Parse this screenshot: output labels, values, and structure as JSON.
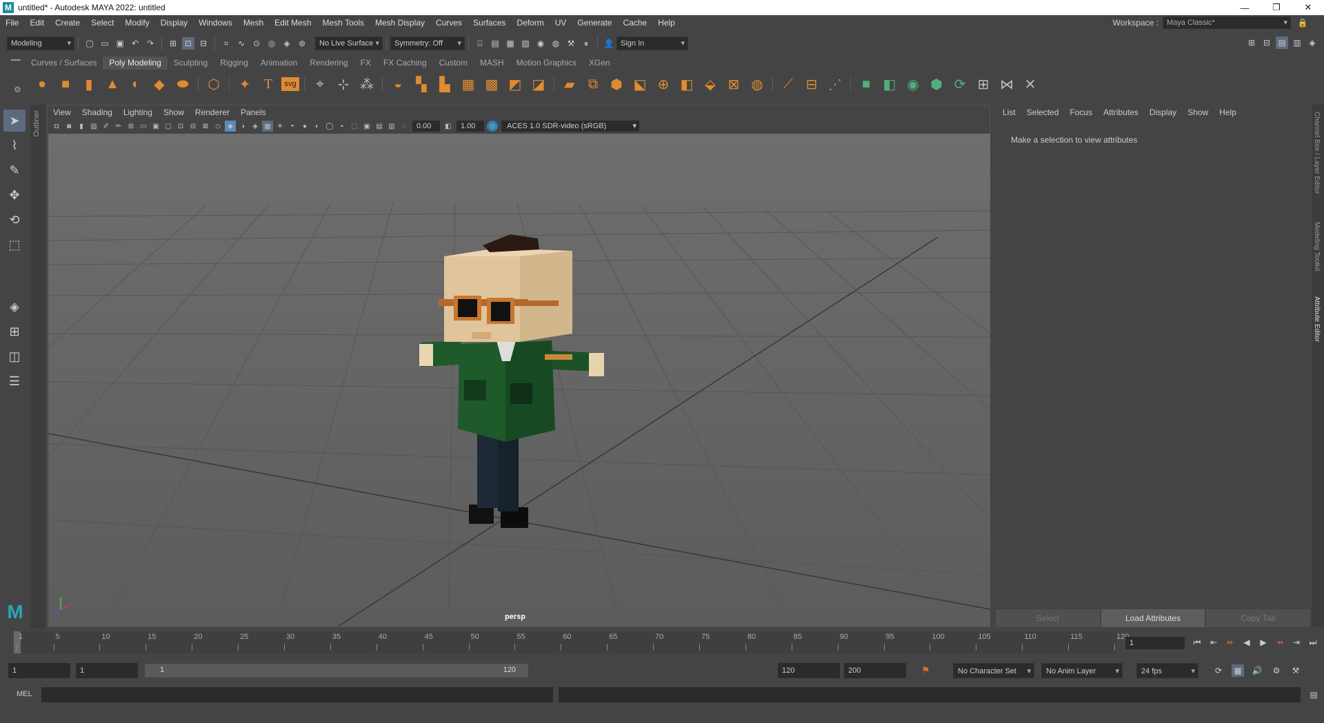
{
  "window": {
    "title": "untitled* - Autodesk MAYA 2022: untitled",
    "logo_letter": "M",
    "minimize": "—",
    "maximize": "❐",
    "close": "✕"
  },
  "menubar": {
    "items": [
      "File",
      "Edit",
      "Create",
      "Select",
      "Modify",
      "Display",
      "Windows",
      "Mesh",
      "Edit Mesh",
      "Mesh Tools",
      "Mesh Display",
      "Curves",
      "Surfaces",
      "Deform",
      "UV",
      "Generate",
      "Cache",
      "Help"
    ],
    "workspace_label": "Workspace :",
    "workspace_value": "Maya Classic*"
  },
  "statusline": {
    "mode": "Modeling",
    "live_surface": "No Live Surface",
    "symmetry": "Symmetry: Off",
    "sign_in": "Sign In"
  },
  "shelf": {
    "tabs": [
      "Curves / Surfaces",
      "Poly Modeling",
      "Sculpting",
      "Rigging",
      "Animation",
      "Rendering",
      "FX",
      "FX Caching",
      "Custom",
      "MASH",
      "Motion Graphics",
      "XGen"
    ],
    "active_tab": "Poly Modeling",
    "svg_label": "svg"
  },
  "viewport": {
    "menu": [
      "View",
      "Shading",
      "Lighting",
      "Show",
      "Renderer",
      "Panels"
    ],
    "exposure": "0.00",
    "gamma": "1.00",
    "color_space": "ACES 1.0 SDR-video (sRGB)",
    "camera_label": "persp"
  },
  "outliner": {
    "label": "Outliner"
  },
  "attribute_editor": {
    "menu": [
      "List",
      "Selected",
      "Focus",
      "Attributes",
      "Display",
      "Show",
      "Help"
    ],
    "message": "Make a selection to view attributes",
    "buttons": {
      "select": "Select",
      "load": "Load Attributes",
      "copy": "Copy Tab"
    }
  },
  "right_tabs": [
    "Channel Box / Layer Editor",
    "Modeling Toolkit",
    "Attribute Editor"
  ],
  "timeslider": {
    "ticks": [
      "1",
      "5",
      "10",
      "15",
      "20",
      "25",
      "30",
      "35",
      "40",
      "45",
      "50",
      "55",
      "60",
      "65",
      "70",
      "75",
      "80",
      "85",
      "90",
      "95",
      "100",
      "105",
      "110",
      "115",
      "120"
    ],
    "current_frame": "1"
  },
  "rangeslider": {
    "start_field": "1",
    "playback_start": "1",
    "range_start": "1",
    "range_end": "120",
    "playback_end": "120",
    "end_field": "200",
    "character_set": "No Character Set",
    "anim_layer": "No Anim Layer",
    "fps": "24 fps"
  },
  "cmdline": {
    "label": "MEL"
  }
}
